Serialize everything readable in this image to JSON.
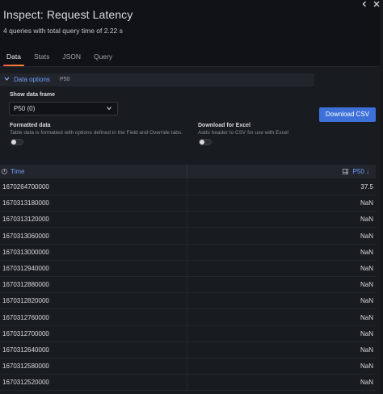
{
  "header": {
    "title": "Inspect: Request Latency",
    "subtitle": "4 queries with total query time of 2.22 s",
    "collapse_icon": "chevron-left-icon",
    "close_icon": "close-icon"
  },
  "tabs": [
    {
      "label": "Data",
      "active": true
    },
    {
      "label": "Stats",
      "active": false
    },
    {
      "label": "JSON",
      "active": false
    },
    {
      "label": "Query",
      "active": false
    }
  ],
  "data_options": {
    "label": "Data options",
    "summary": "P50",
    "show_frame_label": "Show data frame",
    "frame_value": "P50 (0)",
    "formatted_label": "Formatted data",
    "formatted_desc": "Table data is formatted with options defined in the Field and Override tabs.",
    "formatted_on": false,
    "excel_label": "Download for Excel",
    "excel_desc": "Adds header to CSV for use with Excel",
    "excel_on": false
  },
  "download_button": "Download CSV",
  "table": {
    "columns": [
      "Time",
      "P50"
    ],
    "sort_indicator": "↓",
    "rows": [
      [
        "1670264700000",
        "37.5"
      ],
      [
        "1670313180000",
        "NaN"
      ],
      [
        "1670313120000",
        "NaN"
      ],
      [
        "1670313060000",
        "NaN"
      ],
      [
        "1670313000000",
        "NaN"
      ],
      [
        "1670312940000",
        "NaN"
      ],
      [
        "1670312880000",
        "NaN"
      ],
      [
        "1670312820000",
        "NaN"
      ],
      [
        "1670312760000",
        "NaN"
      ],
      [
        "1670312700000",
        "NaN"
      ],
      [
        "1670312640000",
        "NaN"
      ],
      [
        "1670312580000",
        "NaN"
      ],
      [
        "1670312520000",
        "NaN"
      ]
    ]
  },
  "colors": {
    "accent": "#3d71d9",
    "link": "#6e9fff",
    "background": "#111217"
  }
}
